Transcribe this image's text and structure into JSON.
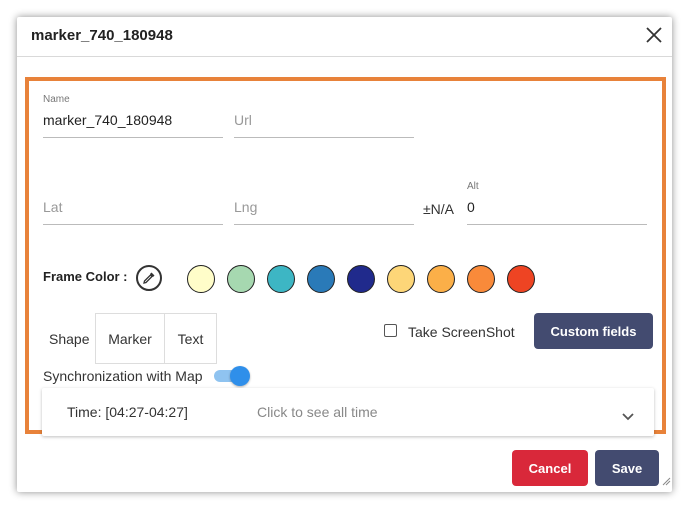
{
  "dialog": {
    "title": "marker_740_180948",
    "close_icon": "close-icon"
  },
  "form": {
    "name": {
      "label": "Name",
      "value": "marker_740_180948"
    },
    "url": {
      "placeholder": "Url"
    },
    "lat": {
      "placeholder": "Lat"
    },
    "lng": {
      "placeholder": "Lng"
    },
    "unit": "±N/A",
    "alt": {
      "label": "Alt",
      "value": "0"
    }
  },
  "frame_color": {
    "label": "Frame Color :",
    "picker_icon": "eyedropper-icon",
    "swatches": [
      "#fffdc9",
      "#a6d8b0",
      "#3db6c4",
      "#2a7ab8",
      "#202a8c",
      "#fdd678",
      "#fbaf48",
      "#f98a3a",
      "#ee4423"
    ]
  },
  "shape": {
    "label": "Shape",
    "options": [
      "Marker",
      "Text"
    ]
  },
  "screenshot": {
    "label": "Take ScreenShot",
    "checked": false
  },
  "custom_fields_label": "Custom fields",
  "sync": {
    "label": "Synchronization with Map",
    "enabled": true
  },
  "time": {
    "label": "Time: [04:27-04:27]",
    "hint": "Click to see all time",
    "chevron_icon": "chevron-down-icon"
  },
  "footer": {
    "cancel_label": "Cancel",
    "save_label": "Save"
  },
  "colors": {
    "accent": "#e8823a",
    "primary": "#434b70",
    "danger": "#d9283a",
    "toggle": "#2f8fea"
  }
}
